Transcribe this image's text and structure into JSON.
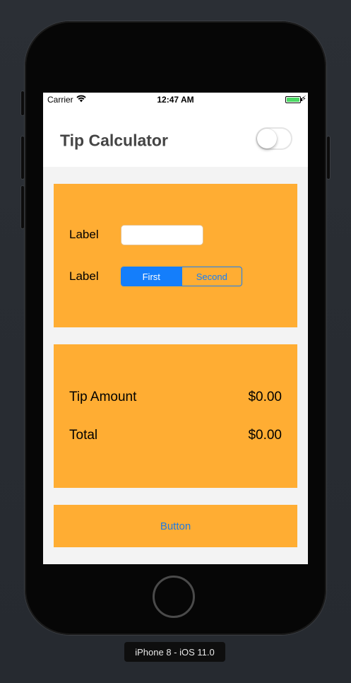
{
  "status_bar": {
    "carrier": "Carrier",
    "time": "12:47 AM",
    "battery_color": "#4cd964"
  },
  "nav": {
    "title": "Tip Calculator",
    "toggle_on": false
  },
  "input_card": {
    "bill_label": "Label",
    "bill_value": "",
    "tip_label": "Label",
    "segments": [
      "First",
      "Second"
    ],
    "selected_segment": "First"
  },
  "result_card": {
    "tip_amount_label": "Tip Amount",
    "tip_amount_value": "$0.00",
    "total_label": "Total",
    "total_value": "$0.00"
  },
  "action": {
    "button_label": "Button"
  },
  "simulator": {
    "device_label": "iPhone 8 - iOS 11.0"
  },
  "colors": {
    "card_background": "#ffad33",
    "accent_blue": "#147efb",
    "screen_background": "#f3f3f3"
  }
}
